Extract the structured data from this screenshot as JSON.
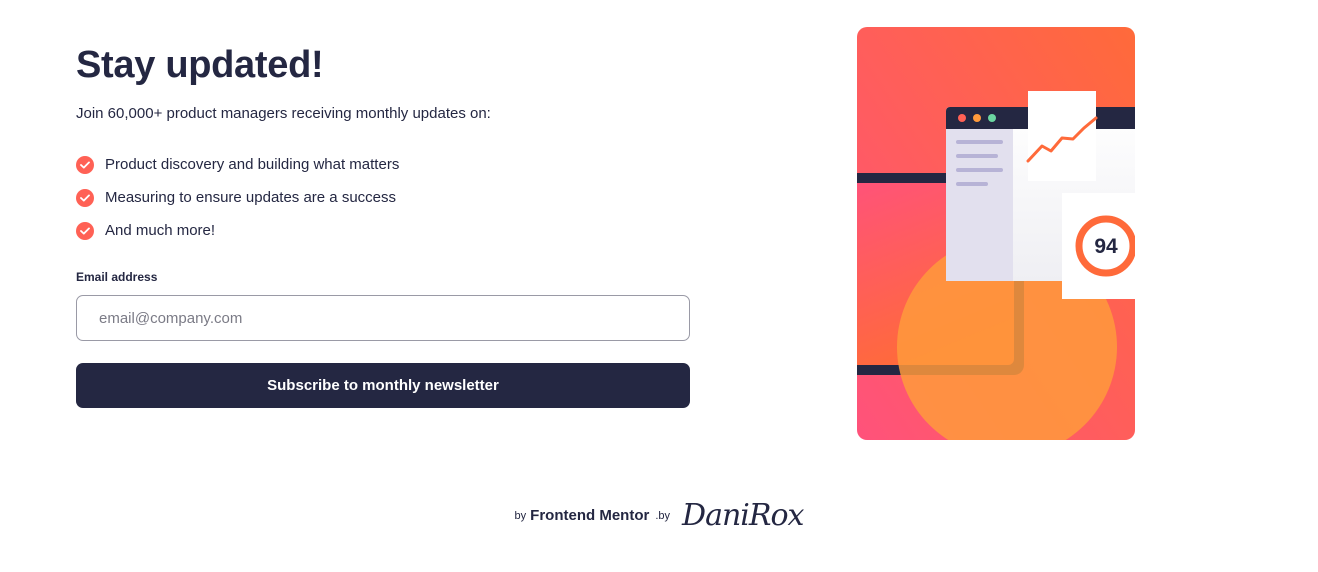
{
  "hero": {
    "title": "Stay updated!",
    "intro": "Join 60,000+ product managers receiving monthly updates on:"
  },
  "features": [
    "Product discovery and building what matters",
    "Measuring to ensure updates are a success",
    "And much more!"
  ],
  "form": {
    "email_label": "Email address",
    "email_placeholder": "email@company.com",
    "submit_label": "Subscribe to monthly newsletter"
  },
  "illustration": {
    "score": "94"
  },
  "footer": {
    "by_prefix": "by",
    "brand": "Frontend Mentor",
    "by_suffix": ".by",
    "author": "DaniRox"
  },
  "colors": {
    "accent": "#ff6155",
    "navy": "#242742",
    "gradient_top": "#ff6a3a",
    "gradient_bottom": "#ff527b"
  },
  "icons": {
    "feature_bullet": "check-circle-icon"
  }
}
